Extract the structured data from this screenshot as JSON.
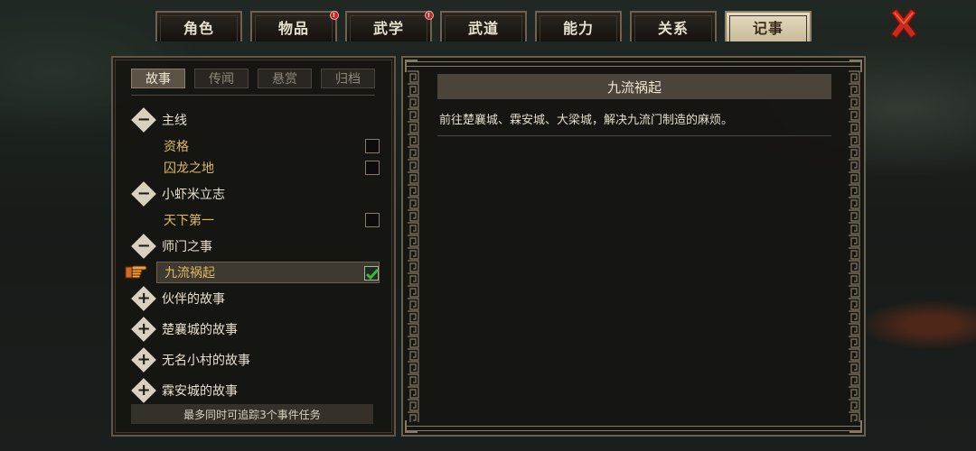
{
  "tabs": [
    {
      "label": "角色",
      "active": false,
      "badge": false
    },
    {
      "label": "物品",
      "active": false,
      "badge": true
    },
    {
      "label": "武学",
      "active": false,
      "badge": true
    },
    {
      "label": "武道",
      "active": false,
      "badge": false
    },
    {
      "label": "能力",
      "active": false,
      "badge": false
    },
    {
      "label": "关系",
      "active": false,
      "badge": false
    },
    {
      "label": "记事",
      "active": true,
      "badge": false
    }
  ],
  "badge_glyph": "!",
  "close_icon": "red-x-icon",
  "subtabs": [
    "故事",
    "传闻",
    "悬赏",
    "归档"
  ],
  "active_subtab": 0,
  "groups": [
    {
      "title": "主线",
      "expanded": true,
      "toggle": "−",
      "quests": [
        {
          "name": "资格",
          "checked": false
        },
        {
          "name": "囚龙之地",
          "checked": false
        }
      ]
    },
    {
      "title": "小虾米立志",
      "expanded": true,
      "toggle": "−",
      "quests": [
        {
          "name": "天下第一",
          "checked": false
        }
      ]
    },
    {
      "title": "师门之事",
      "expanded": true,
      "toggle": "−",
      "quests": [
        {
          "name": "九流祸起",
          "checked": true,
          "selected": true
        }
      ]
    },
    {
      "title": "伙伴的故事",
      "expanded": false,
      "toggle": "+",
      "quests": []
    },
    {
      "title": "楚襄城的故事",
      "expanded": false,
      "toggle": "+",
      "quests": []
    },
    {
      "title": "无名小村的故事",
      "expanded": false,
      "toggle": "+",
      "quests": []
    },
    {
      "title": "霖安城的故事",
      "expanded": false,
      "toggle": "+",
      "quests": []
    }
  ],
  "footer_note": "最多同时可追踪3个事件任务",
  "detail": {
    "title": "九流祸起",
    "description": "前往楚襄城、霖安城、大梁城，解决九流门制造的麻烦。"
  },
  "colors": {
    "quest_text": "#e0b962",
    "panel_bg": "#161411",
    "active_tab": "#e6dcc3",
    "badge": "#c0262b",
    "check_green": "#3bb54a"
  }
}
